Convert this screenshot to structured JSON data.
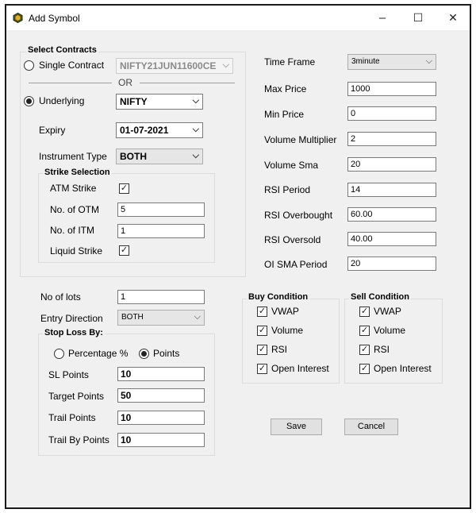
{
  "window": {
    "title": "Add Symbol",
    "minimize": "–",
    "maximize": "☐",
    "close": "✕"
  },
  "contracts": {
    "group_title": "Select Contracts",
    "single_label": "Single Contract",
    "single_value": "NIFTY21JUN11600CE",
    "or_label": "OR",
    "underlying_label": "Underlying",
    "underlying_value": "NIFTY",
    "expiry_label": "Expiry",
    "expiry_value": "01-07-2021",
    "instrument_label": "Instrument Type",
    "instrument_value": "BOTH",
    "strike": {
      "group_title": "Strike Selection",
      "atm_label": "ATM Strike",
      "atm_checked": true,
      "otm_label": "No. of OTM",
      "otm_value": "5",
      "itm_label": "No. of ITM",
      "itm_value": "1",
      "liquid_label": "Liquid Strike",
      "liquid_checked": true
    }
  },
  "params": {
    "time_frame_label": "Time Frame",
    "time_frame_value": "3minute",
    "max_price_label": "Max Price",
    "max_price_value": "1000",
    "min_price_label": "Min Price",
    "min_price_value": "0",
    "vol_mult_label": "Volume Multiplier",
    "vol_mult_value": "2",
    "vol_sma_label": "Volume Sma",
    "vol_sma_value": "20",
    "rsi_period_label": "RSI Period",
    "rsi_period_value": "14",
    "rsi_ob_label": "RSI Overbought",
    "rsi_ob_value": "60.00",
    "rsi_os_label": "RSI Oversold",
    "rsi_os_value": "40.00",
    "oi_sma_label": "OI SMA Period",
    "oi_sma_value": "20"
  },
  "order": {
    "lots_label": "No of lots",
    "lots_value": "1",
    "entry_label": "Entry Direction",
    "entry_value": "BOTH",
    "stoploss": {
      "group_title": "Stop Loss By:",
      "pct_label": "Percentage %",
      "points_label": "Points",
      "sl_label": "SL Points",
      "sl_value": "10",
      "target_label": "Target Points",
      "target_value": "50",
      "trail_label": "Trail Points",
      "trail_value": "10",
      "trailby_label": "Trail By Points",
      "trailby_value": "10"
    }
  },
  "buy": {
    "group_title": "Buy Condition",
    "vwap": "VWAP",
    "volume": "Volume",
    "rsi": "RSI",
    "oi": "Open Interest"
  },
  "sell": {
    "group_title": "Sell Condition",
    "vwap": "VWAP",
    "volume": "Volume",
    "rsi": "RSI",
    "oi": "Open Interest"
  },
  "actions": {
    "save": "Save",
    "cancel": "Cancel"
  },
  "glyphs": {
    "check": "✓",
    "dropdown": "⌵"
  }
}
